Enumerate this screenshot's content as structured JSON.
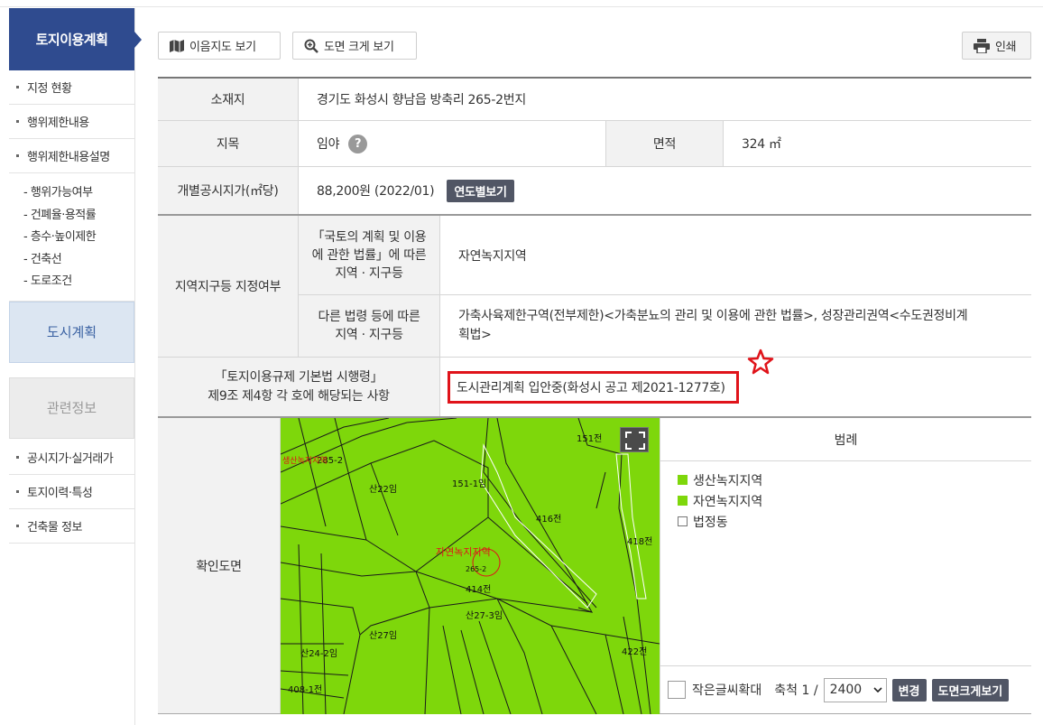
{
  "sidebar": {
    "title": "토지이용계획",
    "items": [
      "지정 현황",
      "행위제한내용",
      "행위제한내용설명"
    ],
    "sub_items": [
      "- 행위가능여부",
      "- 건폐율·용적률",
      "- 층수·높이제한",
      "- 건축선",
      "- 도로조건"
    ],
    "block_city": "도시계획",
    "block_related": "관련정보",
    "related_items": [
      "공시지가·실거래가",
      "토지이력·특성",
      "건축물 정보"
    ]
  },
  "toolbar": {
    "map_label": "이음지도 보기",
    "zoom_label": "도면 크게 보기",
    "print_label": "인쇄"
  },
  "info": {
    "location_label": "소재지",
    "location_value": "경기도 화성시 향남읍 방축리 265-2번지",
    "jimok_label": "지목",
    "jimok_value": "임야",
    "area_label": "면적",
    "area_value": "324 ㎡",
    "price_label": "개별공시지가(㎡당)",
    "price_value": "88,200원 (2022/01)",
    "price_button": "연도별보기",
    "zone_label": "지역지구등 지정여부",
    "zone_law1_label_line1": "「국토의 계획 및 이용",
    "zone_law1_label_line2": "에 관한 법률」에 따른",
    "zone_law1_label_line3": "지역 · 지구등",
    "zone_law1_value": "자연녹지지역",
    "zone_law2_label_line1": "다른 법령 등에 따른",
    "zone_law2_label_line2": "지역 · 지구등",
    "zone_law2_value_line1": "가축사육제한구역(전부제한)<가축분뇨의 관리 및 이용에 관한 법률>, 성장관리권역<수도권정비계",
    "zone_law2_value_line2": "획법>",
    "rule_label_line1": "「토지이용규제 기본법 시행령」",
    "rule_label_line2": "제9조 제4항 각 호에 해당되는 사항",
    "rule_value": "도시관리계획 입안중(화성시 공고 제2021-1277호)",
    "map_label": "확인도면"
  },
  "map": {
    "labels": [
      "151전",
      "151-1임",
      "산22임",
      "416전",
      "418전",
      "414전",
      "산27-3임",
      "산27임",
      "산24-2임",
      "408-1전",
      "422전",
      "285-2",
      "265-2"
    ],
    "zone_text": "자연녹지지역",
    "corner_zone_text": "생산녹지지역"
  },
  "legend": {
    "title": "범례",
    "items": [
      {
        "label": "생산녹지지역",
        "color": "#7ed70b"
      },
      {
        "label": "자연녹지지역",
        "color": "#7ed70b"
      },
      {
        "label": "법정동",
        "color": "#ffffff"
      }
    ]
  },
  "scale": {
    "enlarge_label": "작은글씨확대",
    "scale_label": "축척 1 /",
    "scale_value": "2400",
    "change_button": "변경",
    "big_button": "도면크게보기"
  },
  "colors": {
    "accent": "#2f4b8f",
    "highlight": "#e0131a",
    "map_green": "#7ed70b"
  }
}
